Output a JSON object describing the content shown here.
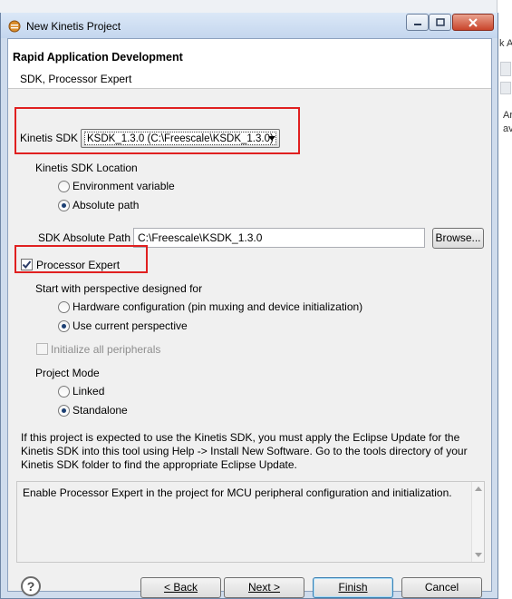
{
  "window": {
    "title": "New Kinetis Project"
  },
  "background": {
    "fragments": [
      "k A",
      "Ar",
      "av"
    ]
  },
  "header": {
    "title": "Rapid Application Development",
    "subtitle": "SDK, Processor Expert"
  },
  "sdk": {
    "label": "Kinetis SDK",
    "selected": "KSDK_1.3.0 (C:\\Freescale\\KSDK_1.3.0)",
    "location_label": "Kinetis SDK Location",
    "location_options": [
      {
        "label": "Environment variable",
        "selected": false
      },
      {
        "label": "Absolute path",
        "selected": true
      }
    ],
    "absolute_path_label": "SDK Absolute Path",
    "absolute_path_value": "C:\\Freescale\\KSDK_1.3.0",
    "browse_label": "Browse..."
  },
  "processor_expert": {
    "label": "Processor Expert",
    "checked": true,
    "perspective_label": "Start with perspective designed for",
    "perspective_options": [
      {
        "label": "Hardware configuration (pin muxing and device initialization)",
        "selected": false
      },
      {
        "label": "Use current perspective",
        "selected": true
      }
    ],
    "init_peripherals_label": "Initialize all peripherals",
    "project_mode_label": "Project Mode",
    "project_mode_options": [
      {
        "label": "Linked",
        "selected": false
      },
      {
        "label": "Standalone",
        "selected": true
      }
    ]
  },
  "info_lines": [
    "If this project is expected to use the Kinetis SDK, you must apply the Eclipse Update for the",
    "Kinetis SDK into this tool using Help -> Install New Software. Go to the tools directory of your",
    "Kinetis SDK folder to find the appropriate Eclipse Update."
  ],
  "description": "Enable Processor Expert in the project for MCU peripheral configuration and initialization.",
  "buttons": {
    "back": "< Back",
    "next": "Next >",
    "finish": "Finish",
    "cancel": "Cancel"
  },
  "help_symbol": "?",
  "colors": {
    "highlight": "#e02020",
    "titlebar": "#c4d6ee",
    "default_button": "#3c7fb1"
  }
}
